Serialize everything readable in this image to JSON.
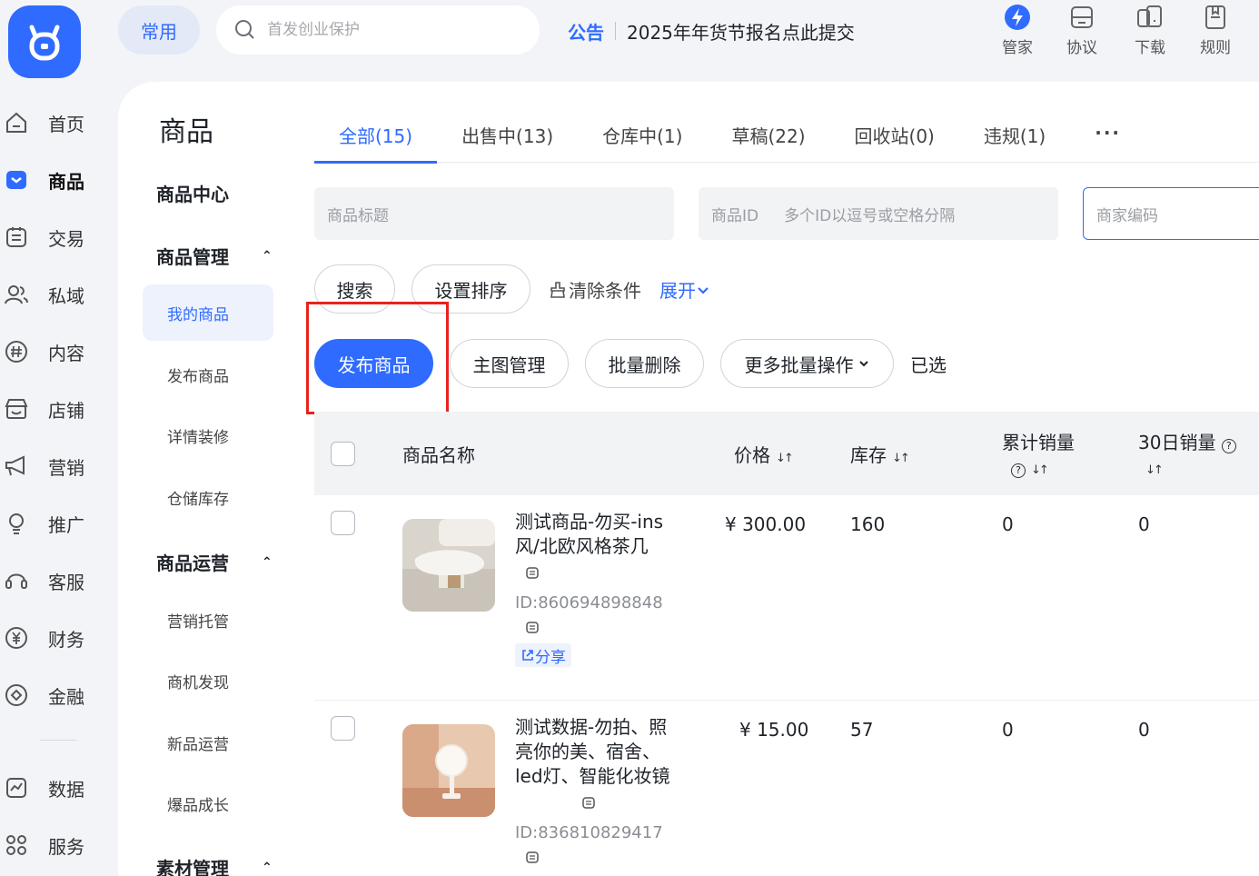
{
  "topbar": {
    "common_label": "常用",
    "search_placeholder": "首发创业保护",
    "notice_tag": "公告",
    "notice_text": "2025年年货节报名点此提交",
    "tools": [
      {
        "label": "管家",
        "icon": "lightning-icon"
      },
      {
        "label": "协议",
        "icon": "agreement-icon"
      },
      {
        "label": "下载",
        "icon": "download-icon"
      },
      {
        "label": "规则",
        "icon": "rules-icon"
      }
    ]
  },
  "sidebar": {
    "items": [
      {
        "label": "首页",
        "icon": "home-icon"
      },
      {
        "label": "商品",
        "icon": "goods-icon"
      },
      {
        "label": "交易",
        "icon": "trade-icon"
      },
      {
        "label": "私域",
        "icon": "users-icon"
      },
      {
        "label": "内容",
        "icon": "hash-icon"
      },
      {
        "label": "店铺",
        "icon": "store-icon"
      },
      {
        "label": "营销",
        "icon": "megaphone-icon"
      },
      {
        "label": "推广",
        "icon": "bulb-icon"
      },
      {
        "label": "客服",
        "icon": "headset-icon"
      },
      {
        "label": "财务",
        "icon": "yen-icon"
      },
      {
        "label": "金融",
        "icon": "finance-icon"
      },
      {
        "label": "数据",
        "icon": "chart-icon"
      },
      {
        "label": "服务",
        "icon": "grid-icon"
      }
    ]
  },
  "subnav": {
    "title": "商品",
    "center": "商品中心",
    "group1": "商品管理",
    "group1_items": [
      "我的商品",
      "发布商品",
      "详情装修",
      "仓储库存"
    ],
    "group2": "商品运营",
    "group2_items": [
      "营销托管",
      "商机发现",
      "新品运营",
      "爆品成长"
    ],
    "group3": "素材管理"
  },
  "tabs": [
    "全部(15)",
    "出售中(13)",
    "仓库中(1)",
    "草稿(22)",
    "回收站(0)",
    "违规(1)",
    "···"
  ],
  "filters": {
    "title_placeholder": "商品标题",
    "id_label": "商品ID",
    "id_placeholder": "多个ID以逗号或空格分隔",
    "code_placeholder": "商家编码"
  },
  "actions": {
    "search": "搜索",
    "sort": "设置排序",
    "clear": "清除条件",
    "expand": "展开",
    "publish": "发布商品",
    "main_image": "主图管理",
    "batch_delete": "批量删除",
    "more_batch": "更多批量操作",
    "selected": "已选"
  },
  "table": {
    "headers": {
      "name": "商品名称",
      "price": "价格",
      "stock": "库存",
      "total_sales": "累计销量",
      "sales_30d": "30日销量"
    },
    "rows": [
      {
        "name": "测试商品-勿买-ins风/北欧风格茶几",
        "id": "ID:860694898848",
        "share": "分享",
        "price": "¥ 300.00",
        "stock": "160",
        "total": "0",
        "d30": "0"
      },
      {
        "name": "测试数据-勿拍、照亮你的美、宿舍、led灯、智能化妆镜",
        "id": "ID:836810829417",
        "price": "¥ 15.00",
        "stock": "57",
        "total": "0",
        "d30": "0"
      }
    ]
  },
  "colors": {
    "accent": "#2f6bff",
    "highlight": "#e8221c"
  }
}
